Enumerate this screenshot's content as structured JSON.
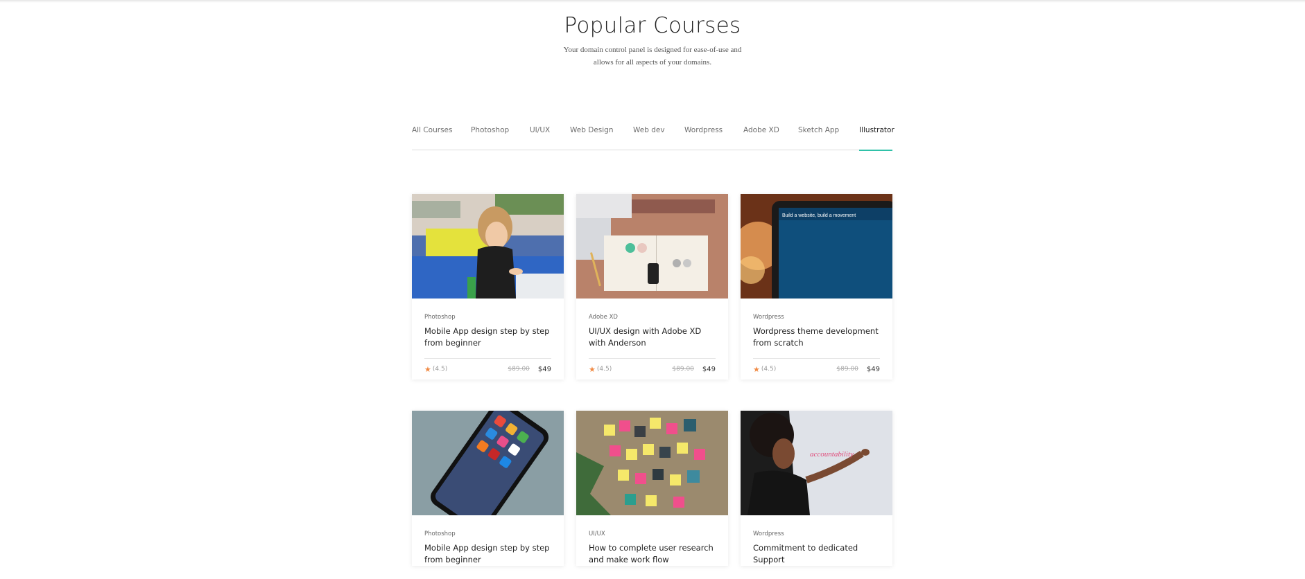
{
  "header": {
    "title": "Popular Courses",
    "subtitle": "Your domain control panel is designed for ease-of-use and allows for all aspects of your domains."
  },
  "tabs": [
    {
      "label": "All Courses",
      "active": false
    },
    {
      "label": "Photoshop",
      "active": false
    },
    {
      "label": "UI/UX",
      "active": false
    },
    {
      "label": "Web Design",
      "active": false
    },
    {
      "label": "Web dev",
      "active": false
    },
    {
      "label": "Wordpress",
      "active": false
    },
    {
      "label": "Adobe XD",
      "active": false
    },
    {
      "label": "Sketch App",
      "active": false
    },
    {
      "label": "Illustrator",
      "active": true
    }
  ],
  "courses": [
    {
      "category": "Photoshop",
      "title": "Mobile App design step by step from beginner",
      "rating": "(4.5)",
      "old_price": "$89.00",
      "price": "$49",
      "image": "girl-drawing-photo"
    },
    {
      "category": "Adobe XD",
      "title": "UI/UX design with Adobe XD with Anderson",
      "rating": "(4.5)",
      "old_price": "$89.00",
      "price": "$49",
      "image": "design-desk-photo"
    },
    {
      "category": "Wordpress",
      "title": "Wordpress theme development from scratch",
      "rating": "(4.5)",
      "old_price": "$89.00",
      "price": "$49",
      "image": "laptop-wordpress-photo",
      "image_text": "Build a website, build a movement"
    },
    {
      "category": "Photoshop",
      "title": "Mobile App design step by step from beginner",
      "image": "smartphone-photo"
    },
    {
      "category": "UI/UX",
      "title": "How to complete user research and make work flow",
      "image": "sticky-notes-wall-photo"
    },
    {
      "category": "Wordpress",
      "title": "Commitment to dedicated Support",
      "image": "whiteboard-writing-photo",
      "image_text": "accountability"
    }
  ],
  "colors": {
    "accent": "#2fc1a8",
    "star": "#f08a44"
  }
}
